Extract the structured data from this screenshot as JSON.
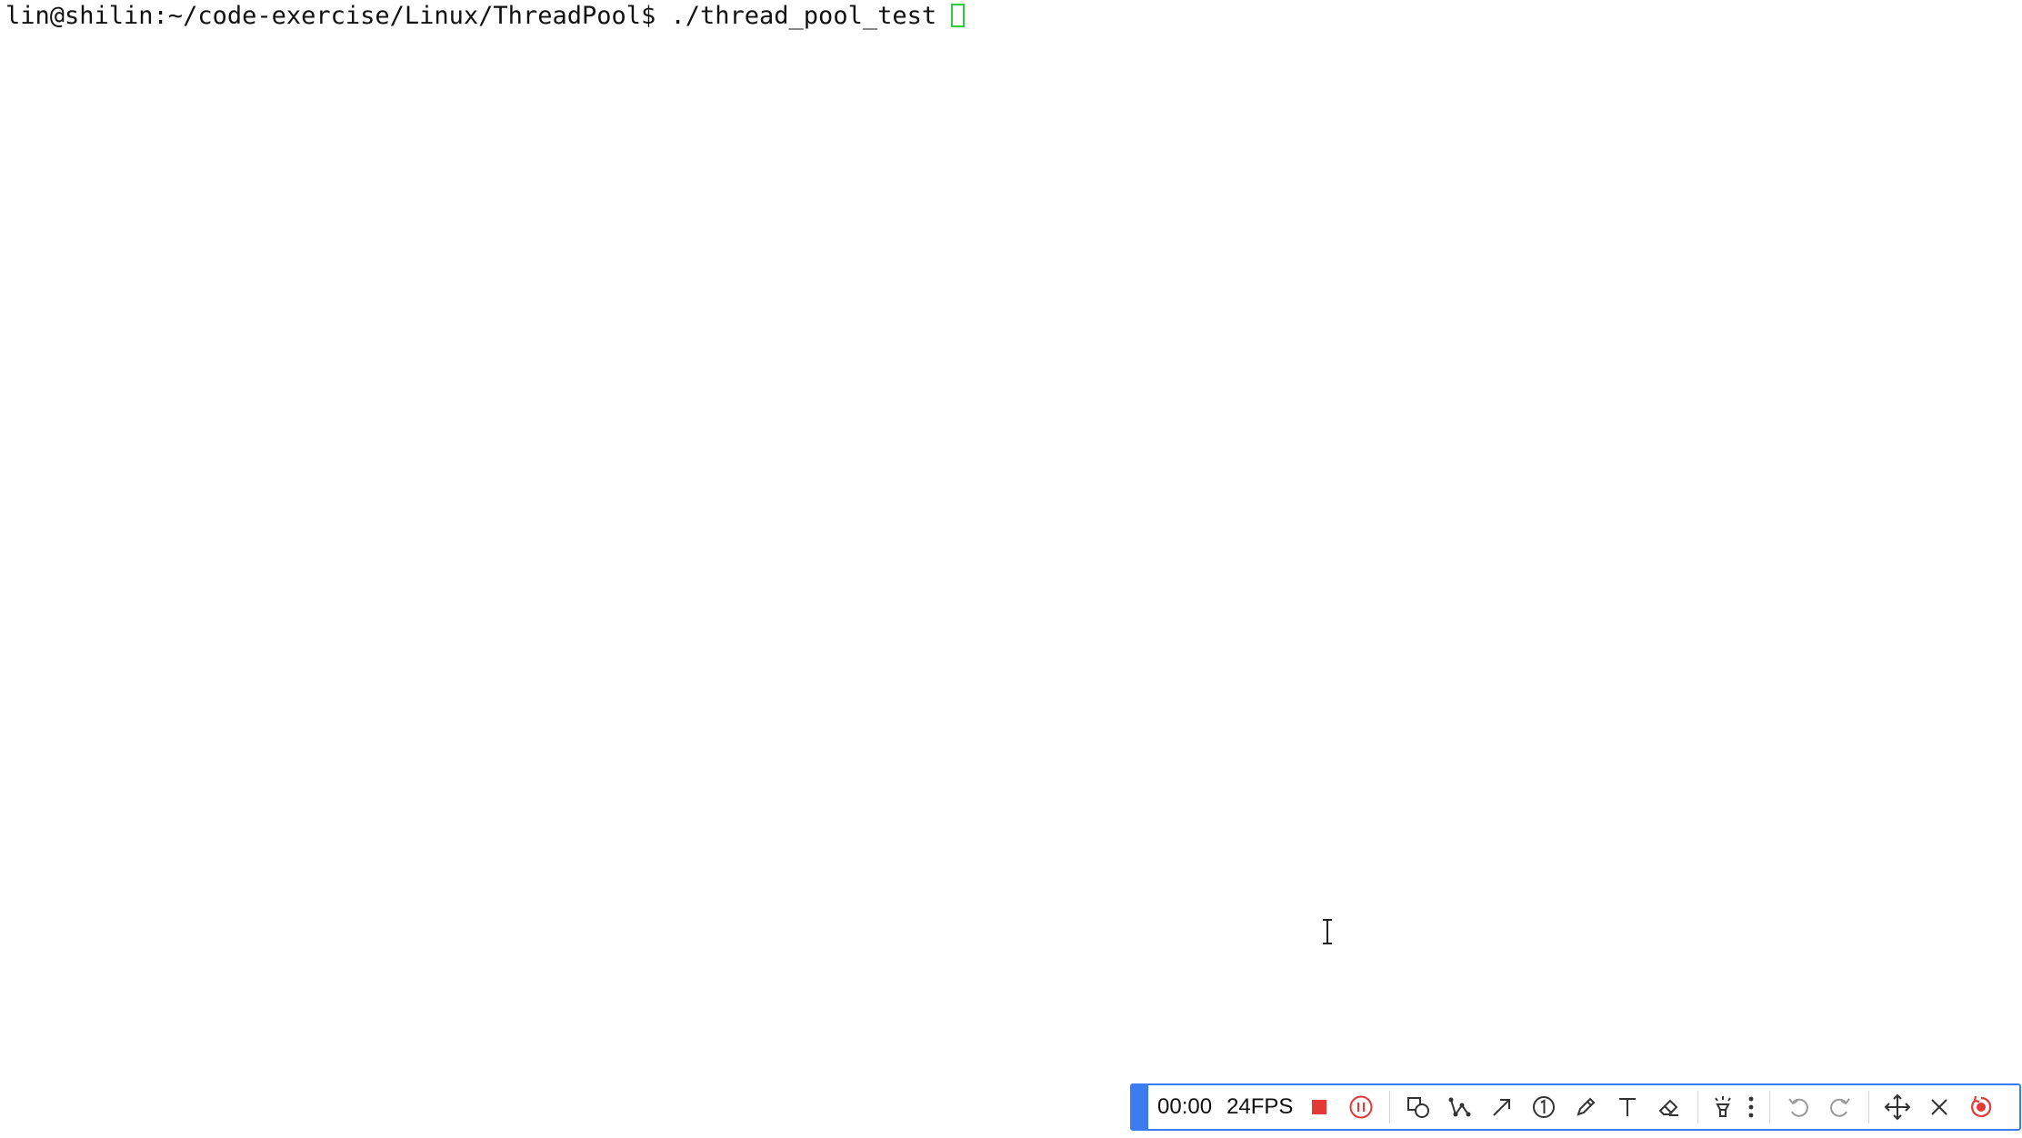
{
  "terminal": {
    "prompt": "lin@shilin:~/code-exercise/Linux/ThreadPool$",
    "command": " ./thread_pool_test"
  },
  "recorder_toolbar": {
    "timer": "00:00",
    "fps": "24FPS",
    "accent_color": "#3b7cf0",
    "record_color": "#e53935",
    "tools": [
      "stop-icon",
      "pause-icon",
      "shapes-icon",
      "polyline-icon",
      "arrow-icon",
      "numbered-marker-icon",
      "pen-icon",
      "text-icon",
      "eraser-icon",
      "spotlight-icon",
      "more-icon",
      "undo-icon",
      "redo-icon",
      "move-icon",
      "close-icon",
      "restart-record-icon"
    ]
  }
}
